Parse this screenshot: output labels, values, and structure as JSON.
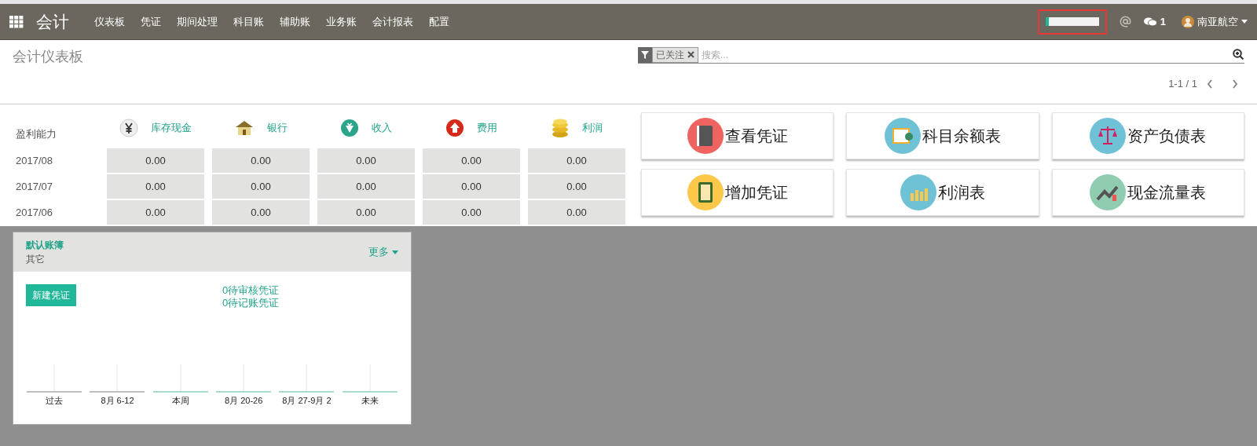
{
  "navbar": {
    "app_title": "会计",
    "menu": [
      "仪表板",
      "凭证",
      "期间处理",
      "科目账",
      "辅助账",
      "业务账",
      "会计报表",
      "配置"
    ],
    "progress": {
      "level": 0.06
    },
    "messages_count": "1",
    "user": "南亚航空"
  },
  "control_panel": {
    "breadcrumb": "会计仪表板",
    "search": {
      "facet": "已关注",
      "placeholder": "搜索..."
    },
    "pager": "1-1 / 1"
  },
  "profit_table": {
    "title": "盈利能力",
    "columns": [
      {
        "label": "库存现金",
        "kind": "cash"
      },
      {
        "label": "银行",
        "kind": "bank"
      },
      {
        "label": "收入",
        "kind": "income"
      },
      {
        "label": "费用",
        "kind": "expense"
      },
      {
        "label": "利润",
        "kind": "profit"
      }
    ],
    "rows": [
      {
        "period": "2017/08",
        "values": [
          "0.00",
          "0.00",
          "0.00",
          "0.00",
          "0.00"
        ]
      },
      {
        "period": "2017/07",
        "values": [
          "0.00",
          "0.00",
          "0.00",
          "0.00",
          "0.00"
        ]
      },
      {
        "period": "2017/06",
        "values": [
          "0.00",
          "0.00",
          "0.00",
          "0.00",
          "0.00"
        ]
      }
    ]
  },
  "shortcuts": [
    {
      "label": "查看凭证",
      "kind": "voucher"
    },
    {
      "label": "科目余额表",
      "kind": "balance"
    },
    {
      "label": "资产负债表",
      "kind": "scale"
    },
    {
      "label": "增加凭证",
      "kind": "calculator"
    },
    {
      "label": "利润表",
      "kind": "bars"
    },
    {
      "label": "现金流量表",
      "kind": "trend"
    }
  ],
  "journal_card": {
    "title": "默认账簿",
    "subtitle": "其它",
    "more": "更多",
    "new_button": "新建凭证",
    "links": [
      "0待审核凭证",
      "0待记账凭证"
    ],
    "periods": [
      {
        "label": "过去",
        "color": "#bfbfbf"
      },
      {
        "label": "8月 6-12",
        "color": "#bfbfbf"
      },
      {
        "label": "本周",
        "color": "#a9dccf"
      },
      {
        "label": "8月 20-26",
        "color": "#a9dccf"
      },
      {
        "label": "8月 27-9月 2",
        "color": "#a9dccf"
      },
      {
        "label": "未来",
        "color": "#a9dccf"
      }
    ]
  }
}
